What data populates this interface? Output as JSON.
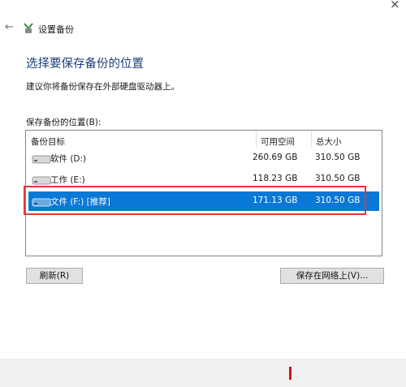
{
  "window": {
    "close_glyph": "×",
    "back_glyph": "←",
    "title": "设置备份"
  },
  "page": {
    "heading": "选择要保存备份的位置",
    "hint": "建议你将备份保存在外部硬盘驱动器上。",
    "list_label": "保存备份的位置(B):"
  },
  "list": {
    "columns": [
      "备份目标",
      "可用空间",
      "总大小"
    ],
    "rows": [
      {
        "name": "软件 (D:)",
        "free": "260.69 GB",
        "total": "310.50 GB",
        "icon": "drive-icon",
        "selected": false
      },
      {
        "name": "工作 (E:)",
        "free": "118.23 GB",
        "total": "310.50 GB",
        "icon": "drive-icon",
        "selected": false
      },
      {
        "name": "文件 (F:) [推荐]",
        "free": "171.13 GB",
        "total": "310.50 GB",
        "icon": "drive-icon",
        "selected": true
      }
    ]
  },
  "buttons": {
    "refresh": "刷新(R)",
    "save_network": "保存在网络上(V)..."
  },
  "colors": {
    "accent": "#0a78d7",
    "heading": "#1c3f7a",
    "highlight_box": "#e0393d"
  }
}
